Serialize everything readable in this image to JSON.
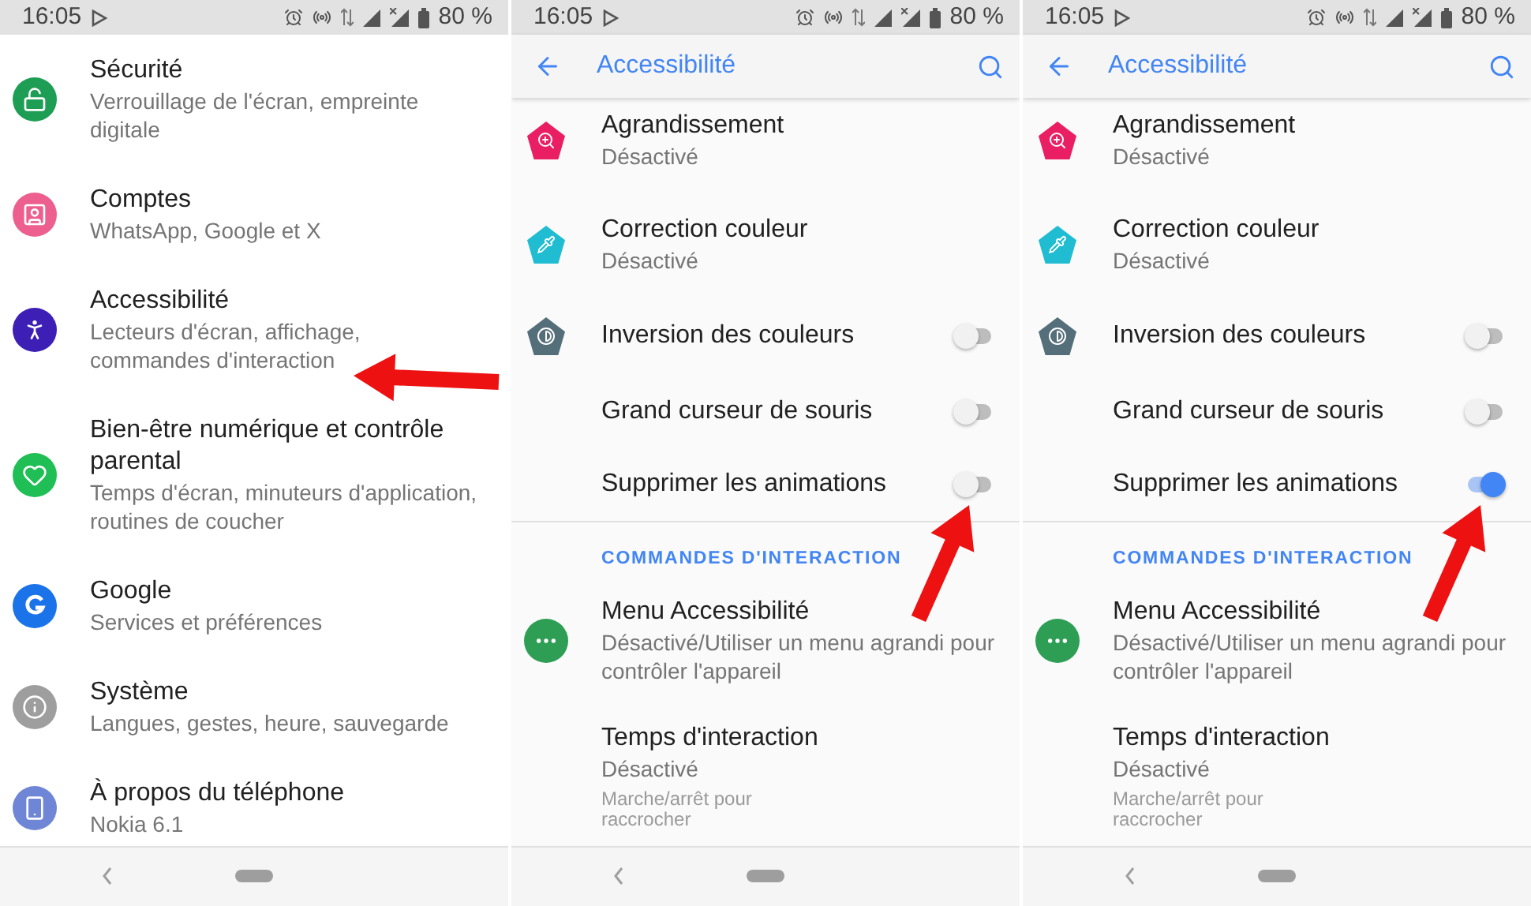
{
  "screens": [
    {
      "kind": "settings",
      "status_bar": {
        "time": "16:05",
        "battery": "80 %"
      },
      "items": [
        {
          "title": "Sécurité",
          "subtitle": "Verrouillage de l'écran, empreinte digitale",
          "color": "#1e9e54"
        },
        {
          "title": "Comptes",
          "subtitle": "WhatsApp, Google et X",
          "color": "#ec5f8f"
        },
        {
          "title": "Accessibilité",
          "subtitle": "Lecteurs d'écran, affichage, commandes d'interaction",
          "color": "#3d1fb5"
        },
        {
          "title": "Bien-être numérique et contrôle parental",
          "subtitle": "Temps d'écran, minuteurs d'application, routines de coucher",
          "color": "#1fbf55"
        },
        {
          "title": "Google",
          "subtitle": "Services et préférences",
          "color": "#1a73e8"
        },
        {
          "title": "Système",
          "subtitle": "Langues, gestes, heure, sauvegarde",
          "color": "#9e9e9e"
        },
        {
          "title": "À propos du téléphone",
          "subtitle": "Nokia 6.1",
          "color": "#6f86d6"
        }
      ]
    },
    {
      "kind": "accessibility",
      "status_bar": {
        "time": "16:05",
        "battery": "80 %"
      },
      "app_bar": {
        "title": "Accessibilité"
      },
      "items": [
        {
          "kind": "link",
          "title": "Agrandissement",
          "subtitle": "Désactivé",
          "color": "#e91e63"
        },
        {
          "kind": "link",
          "title": "Correction couleur",
          "subtitle": "Désactivé",
          "color": "#1fbcd2"
        },
        {
          "kind": "switch",
          "title": "Inversion des couleurs",
          "on": false,
          "color": "#546e7a"
        },
        {
          "kind": "switch",
          "title": "Grand curseur de souris",
          "on": false
        },
        {
          "kind": "switch",
          "title": "Supprimer les animations",
          "on": false
        }
      ],
      "section": {
        "header": "COMMANDES D'INTERACTION",
        "items": [
          {
            "kind": "link",
            "title": "Menu Accessibilité",
            "subtitle": "Désactivé/Utiliser un menu agrandi pour contrôler l'appareil",
            "color": "#2e9e55"
          },
          {
            "kind": "link",
            "title": "Temps d'interaction",
            "subtitle": "Désactivé"
          }
        ]
      },
      "faded_item": {
        "title": "Marche/arrêt pour raccrocher"
      }
    },
    {
      "kind": "accessibility",
      "status_bar": {
        "time": "16:05",
        "battery": "80 %"
      },
      "app_bar": {
        "title": "Accessibilité"
      },
      "items": [
        {
          "kind": "link",
          "title": "Agrandissement",
          "subtitle": "Désactivé",
          "color": "#e91e63"
        },
        {
          "kind": "link",
          "title": "Correction couleur",
          "subtitle": "Désactivé",
          "color": "#1fbcd2"
        },
        {
          "kind": "switch",
          "title": "Inversion des couleurs",
          "on": false,
          "color": "#546e7a"
        },
        {
          "kind": "switch",
          "title": "Grand curseur de souris",
          "on": false
        },
        {
          "kind": "switch",
          "title": "Supprimer les animations",
          "on": true
        }
      ],
      "section": {
        "header": "COMMANDES D'INTERACTION",
        "items": [
          {
            "kind": "link",
            "title": "Menu Accessibilité",
            "subtitle": "Désactivé/Utiliser un menu agrandi pour contrôler l'appareil",
            "color": "#2e9e55"
          },
          {
            "kind": "link",
            "title": "Temps d'interaction",
            "subtitle": "Désactivé"
          }
        ]
      },
      "faded_item": {
        "title": "Marche/arrêt pour raccrocher"
      }
    }
  ]
}
